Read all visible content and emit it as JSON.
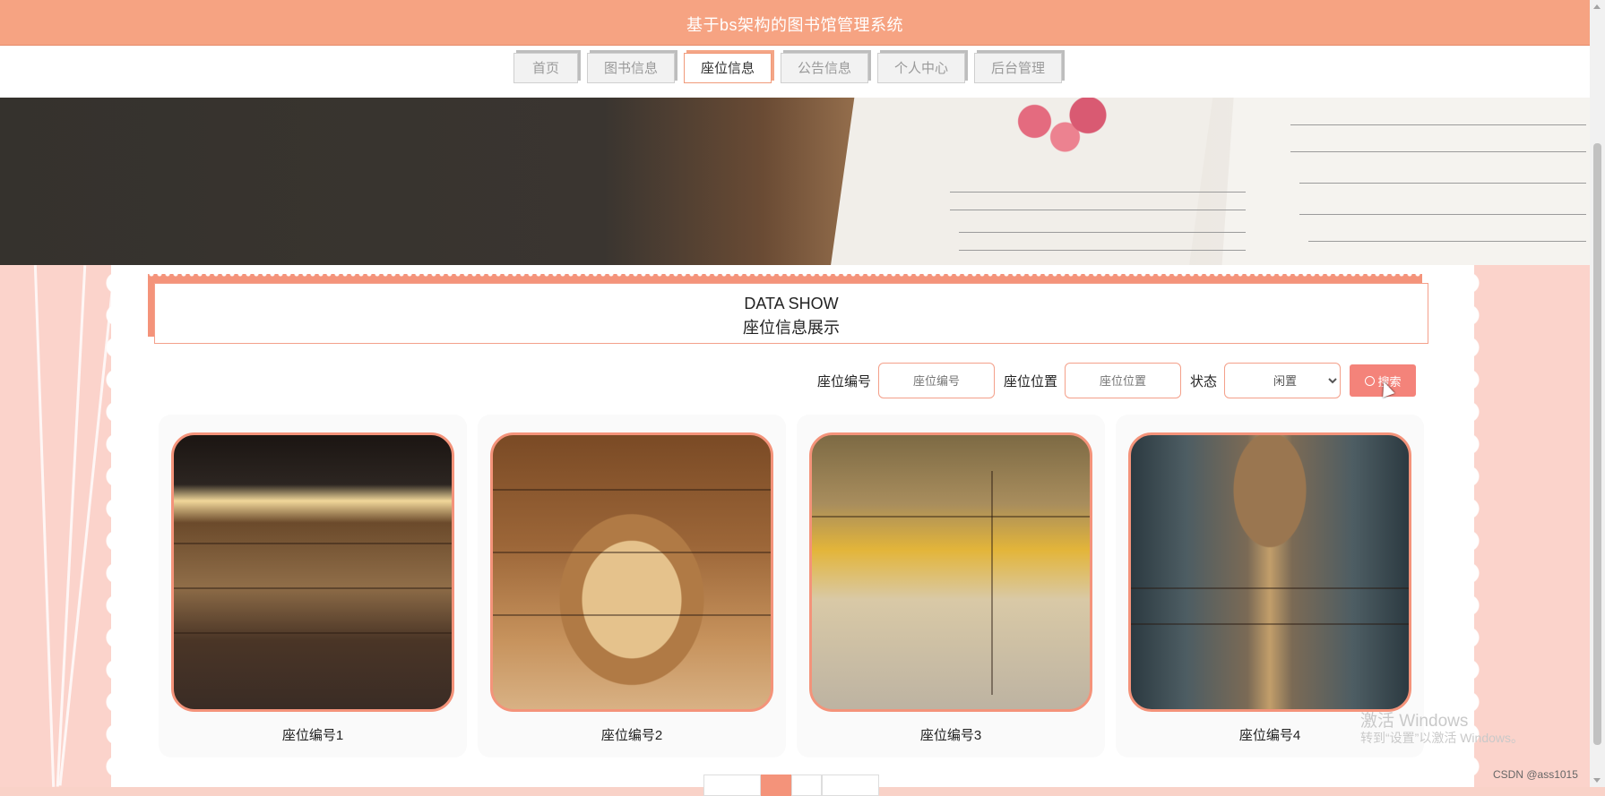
{
  "header": {
    "title": "基于bs架构的图书馆管理系统"
  },
  "nav": {
    "tabs": [
      {
        "label": "首页",
        "active": false
      },
      {
        "label": "图书信息",
        "active": false
      },
      {
        "label": "座位信息",
        "active": true
      },
      {
        "label": "公告信息",
        "active": false
      },
      {
        "label": "个人中心",
        "active": false
      },
      {
        "label": "后台管理",
        "active": false
      }
    ]
  },
  "section": {
    "title_en": "DATA SHOW",
    "title_cn": "座位信息展示"
  },
  "search": {
    "seat_no_label": "座位编号",
    "seat_no_placeholder": "座位编号",
    "seat_loc_label": "座位位置",
    "seat_loc_placeholder": "座位位置",
    "status_label": "状态",
    "status_value": "闲置",
    "button_label": "搜索"
  },
  "cards": [
    {
      "caption": "座位编号1"
    },
    {
      "caption": "座位编号2"
    },
    {
      "caption": "座位编号3"
    },
    {
      "caption": "座位编号4"
    }
  ],
  "watermark": {
    "line1": "激活 Windows",
    "line2": "转到“设置”以激活 Windows。"
  },
  "credit": "CSDN @ass1015",
  "colors": {
    "accent": "#f6a382",
    "button": "#f4837a",
    "side": "#fbd3cb"
  }
}
